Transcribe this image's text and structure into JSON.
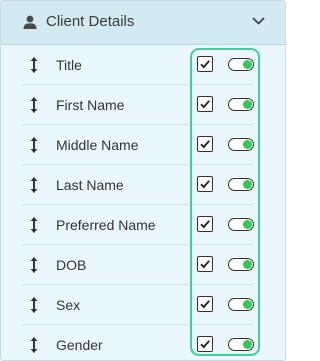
{
  "header": {
    "title": "Client Details",
    "icon": "user-icon",
    "toggle_icon": "chevron-down-icon"
  },
  "fields": [
    {
      "label": "Title",
      "checked": true,
      "enabled": true
    },
    {
      "label": "First Name",
      "checked": true,
      "enabled": true
    },
    {
      "label": "Middle Name",
      "checked": true,
      "enabled": true
    },
    {
      "label": "Last Name",
      "checked": true,
      "enabled": true
    },
    {
      "label": "Preferred Name",
      "checked": true,
      "enabled": true
    },
    {
      "label": "DOB",
      "checked": true,
      "enabled": true
    },
    {
      "label": "Sex",
      "checked": true,
      "enabled": true
    },
    {
      "label": "Gender",
      "checked": true,
      "enabled": true
    }
  ],
  "colors": {
    "toggle_on": "#34c759",
    "highlight": "#3fd19a",
    "header_bg": "#d3eaf3",
    "panel_bg": "#eaf8fd"
  }
}
